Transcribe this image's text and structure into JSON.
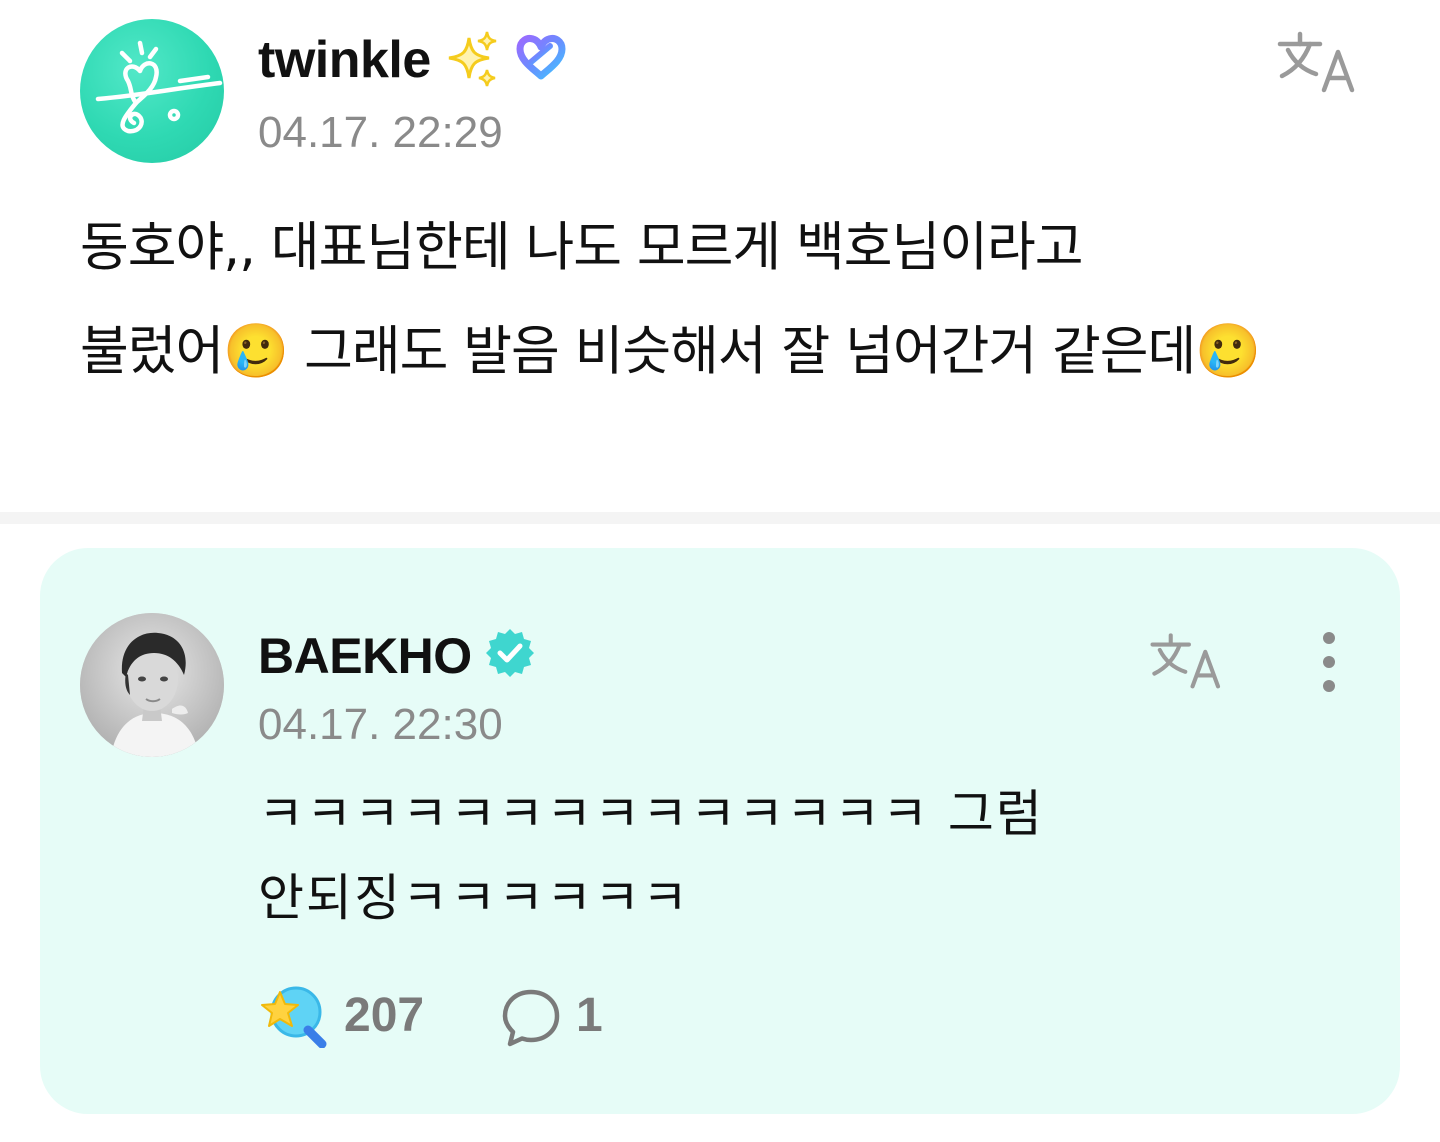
{
  "post": {
    "author": "twinkle",
    "timestamp": "04.17. 22:29",
    "body_lines": [
      "동호야,, 대표님한테 나도 모르게 백호님이라고",
      "불렀어🥲 그래도 발음 비슷해서 잘 넘어간거 같은데🥲"
    ],
    "icons": {
      "avatar": "heart-doodle-avatar",
      "decoration": "sparkle-icon",
      "badge": "fan-badge-icon",
      "translate": "translate-icon"
    }
  },
  "reply": {
    "author": "BAEKHO",
    "timestamp": "04.17. 22:30",
    "body_lines": [
      "ㅋㅋㅋㅋㅋㅋㅋㅋㅋㅋㅋㅋㅋㅋ 그럼",
      "안되징ㅋㅋㅋㅋㅋㅋ"
    ],
    "like_count": "207",
    "comment_count": "1",
    "icons": {
      "verified": "verified-icon",
      "translate": "translate-icon",
      "more": "more-vertical-icon",
      "like": "lightstick-icon",
      "comment": "comment-bubble-icon"
    }
  },
  "colors": {
    "reply_background": "#e6fcf7",
    "avatar_teal": "#2fd9b3",
    "verified_teal": "#3fd6cf",
    "muted_text": "#8a8a8a",
    "sparkle_yellow": "#f5cc1d"
  }
}
